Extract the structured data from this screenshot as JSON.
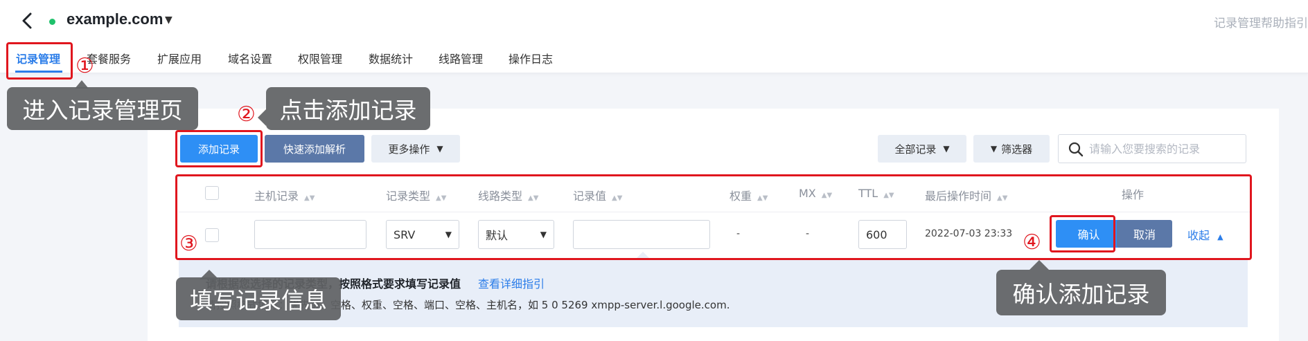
{
  "header": {
    "domain": "example.com",
    "help_text": "记录管理帮助指引"
  },
  "tabs": [
    {
      "label": "记录管理",
      "active": true
    },
    {
      "label": "套餐服务"
    },
    {
      "label": "扩展应用"
    },
    {
      "label": "域名设置"
    },
    {
      "label": "权限管理"
    },
    {
      "label": "数据统计"
    },
    {
      "label": "线路管理"
    },
    {
      "label": "操作日志"
    }
  ],
  "toolbar": {
    "add_record": "添加记录",
    "quick_add": "快速添加解析",
    "more_actions": "更多操作",
    "all_records": "全部记录",
    "filter": "筛选器",
    "search_placeholder": "请输入您要搜索的记录"
  },
  "table": {
    "headers": [
      "主机记录",
      "记录类型",
      "线路类型",
      "记录值",
      "权重",
      "MX",
      "TTL",
      "最后操作时间",
      "操作"
    ]
  },
  "edit_row": {
    "host": "",
    "record_type": "SRV",
    "line_type": "默认",
    "value": "",
    "weight": "-",
    "mx": "-",
    "ttl": "600",
    "last_modified": "2022-07-03 23:33",
    "confirm": "确认",
    "cancel": "取消",
    "collapse": "收起"
  },
  "tip": {
    "title": "请根据您选择的记录类型，按照格式要求填写记录值",
    "link": "查看详细指引",
    "desc": "请按照格式填写：优先级、空格、权重、空格、端口、空格、主机名，如 5 0 5269 xmpp-server.l.google.com."
  },
  "annotations": {
    "steps": [
      "①",
      "②",
      "③",
      "④"
    ],
    "callouts": [
      "进入记录管理页",
      "点击添加记录",
      "填写记录信息",
      "确认添加记录"
    ]
  },
  "colors": {
    "primary": "#2e8ff5",
    "secondary": "#5b78a8",
    "status_dot": "#1fc16b",
    "annotation_red": "#e0161e",
    "callout_bg": "#606264"
  }
}
